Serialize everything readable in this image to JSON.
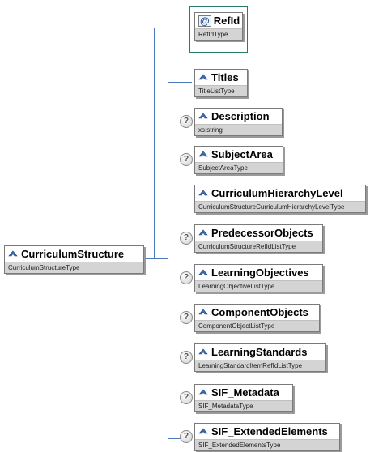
{
  "root": {
    "name": "CurriculumStructure",
    "type": "CurriculumStructureType"
  },
  "attribute": {
    "name": "RefId",
    "type": "RefIdType"
  },
  "elements": [
    {
      "name": "Titles",
      "type": "TitleListType",
      "optional": false
    },
    {
      "name": "Description",
      "type": "xs:string",
      "optional": true
    },
    {
      "name": "SubjectArea",
      "type": "SubjectAreaType",
      "optional": true
    },
    {
      "name": "CurriculumHierarchyLevel",
      "type": "CurriculumStructureCurriculumHierarchyLevelType",
      "optional": false
    },
    {
      "name": "PredecessorObjects",
      "type": "CurriculumStructureRefIdListType",
      "optional": true
    },
    {
      "name": "LearningObjectives",
      "type": "LearningObjectiveListType",
      "optional": true
    },
    {
      "name": "ComponentObjects",
      "type": "ComponentObjectListType",
      "optional": true
    },
    {
      "name": "LearningStandards",
      "type": "LearningStandardItemRefIdListType",
      "optional": true
    },
    {
      "name": "SIF_Metadata",
      "type": "SIF_MetadataType",
      "optional": true
    },
    {
      "name": "SIF_ExtendedElements",
      "type": "SIF_ExtendedElementsType",
      "optional": true
    }
  ],
  "icons": {
    "element": "element-icon",
    "attribute": "attribute-icon",
    "optional": "optional-icon"
  },
  "colors": {
    "connector": "#4a7abd",
    "attribute_border": "#2a7a6a",
    "type_bar": "#d4d4d4"
  }
}
